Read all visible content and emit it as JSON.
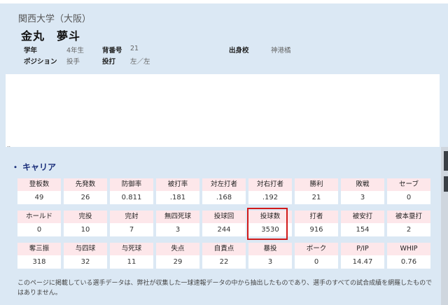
{
  "profile": {
    "university": "関西大学（大阪）",
    "name": "金丸　夢斗",
    "fields": [
      {
        "label": "学年",
        "value": "4年生"
      },
      {
        "label": "背番号",
        "value": "21"
      },
      {
        "label": "出身校",
        "value": "神港橘"
      },
      {
        "label": "ポジション",
        "value": "投手"
      },
      {
        "label": "投打",
        "value": "左／左"
      }
    ]
  },
  "career": {
    "title": "キャリア",
    "bullet": "・",
    "rows": [
      [
        {
          "label": "登板数",
          "value": "49"
        },
        {
          "label": "先発数",
          "value": "26"
        },
        {
          "label": "防御率",
          "value": "0.811"
        },
        {
          "label": "被打率",
          "value": ".181"
        },
        {
          "label": "対左打者",
          "value": ".168"
        },
        {
          "label": "対右打者",
          "value": ".192"
        },
        {
          "label": "勝利",
          "value": "21"
        },
        {
          "label": "敗戦",
          "value": "3"
        },
        {
          "label": "セーブ",
          "value": "0"
        }
      ],
      [
        {
          "label": "ホールド",
          "value": "0"
        },
        {
          "label": "完投",
          "value": "10"
        },
        {
          "label": "完封",
          "value": "7"
        },
        {
          "label": "無四死球",
          "value": "3"
        },
        {
          "label": "投球回",
          "value": "244"
        },
        {
          "label": "投球数",
          "value": "3530"
        },
        {
          "label": "打者",
          "value": "916"
        },
        {
          "label": "被安打",
          "value": "154"
        },
        {
          "label": "被本塁打",
          "value": "2"
        }
      ],
      [
        {
          "label": "奪三振",
          "value": "318"
        },
        {
          "label": "与四球",
          "value": "32"
        },
        {
          "label": "与死球",
          "value": "11"
        },
        {
          "label": "失点",
          "value": "29"
        },
        {
          "label": "自責点",
          "value": "22"
        },
        {
          "label": "暴投",
          "value": "3"
        },
        {
          "label": "ボーク",
          "value": "0"
        },
        {
          "label": "P/IP",
          "value": "14.47"
        },
        {
          "label": "WHIP",
          "value": "0.76"
        }
      ]
    ]
  },
  "footnote": "このページに掲載している選手データは、弊社が収集した一球速報データの中から抽出したものであり、選手のすべての試合成績を網羅したものではありません。",
  "ellipsis": "..",
  "colors": {
    "accent_title": "#1a2e7a",
    "highlight_border": "#d11a1a",
    "label_bg": "#fde7ea"
  }
}
